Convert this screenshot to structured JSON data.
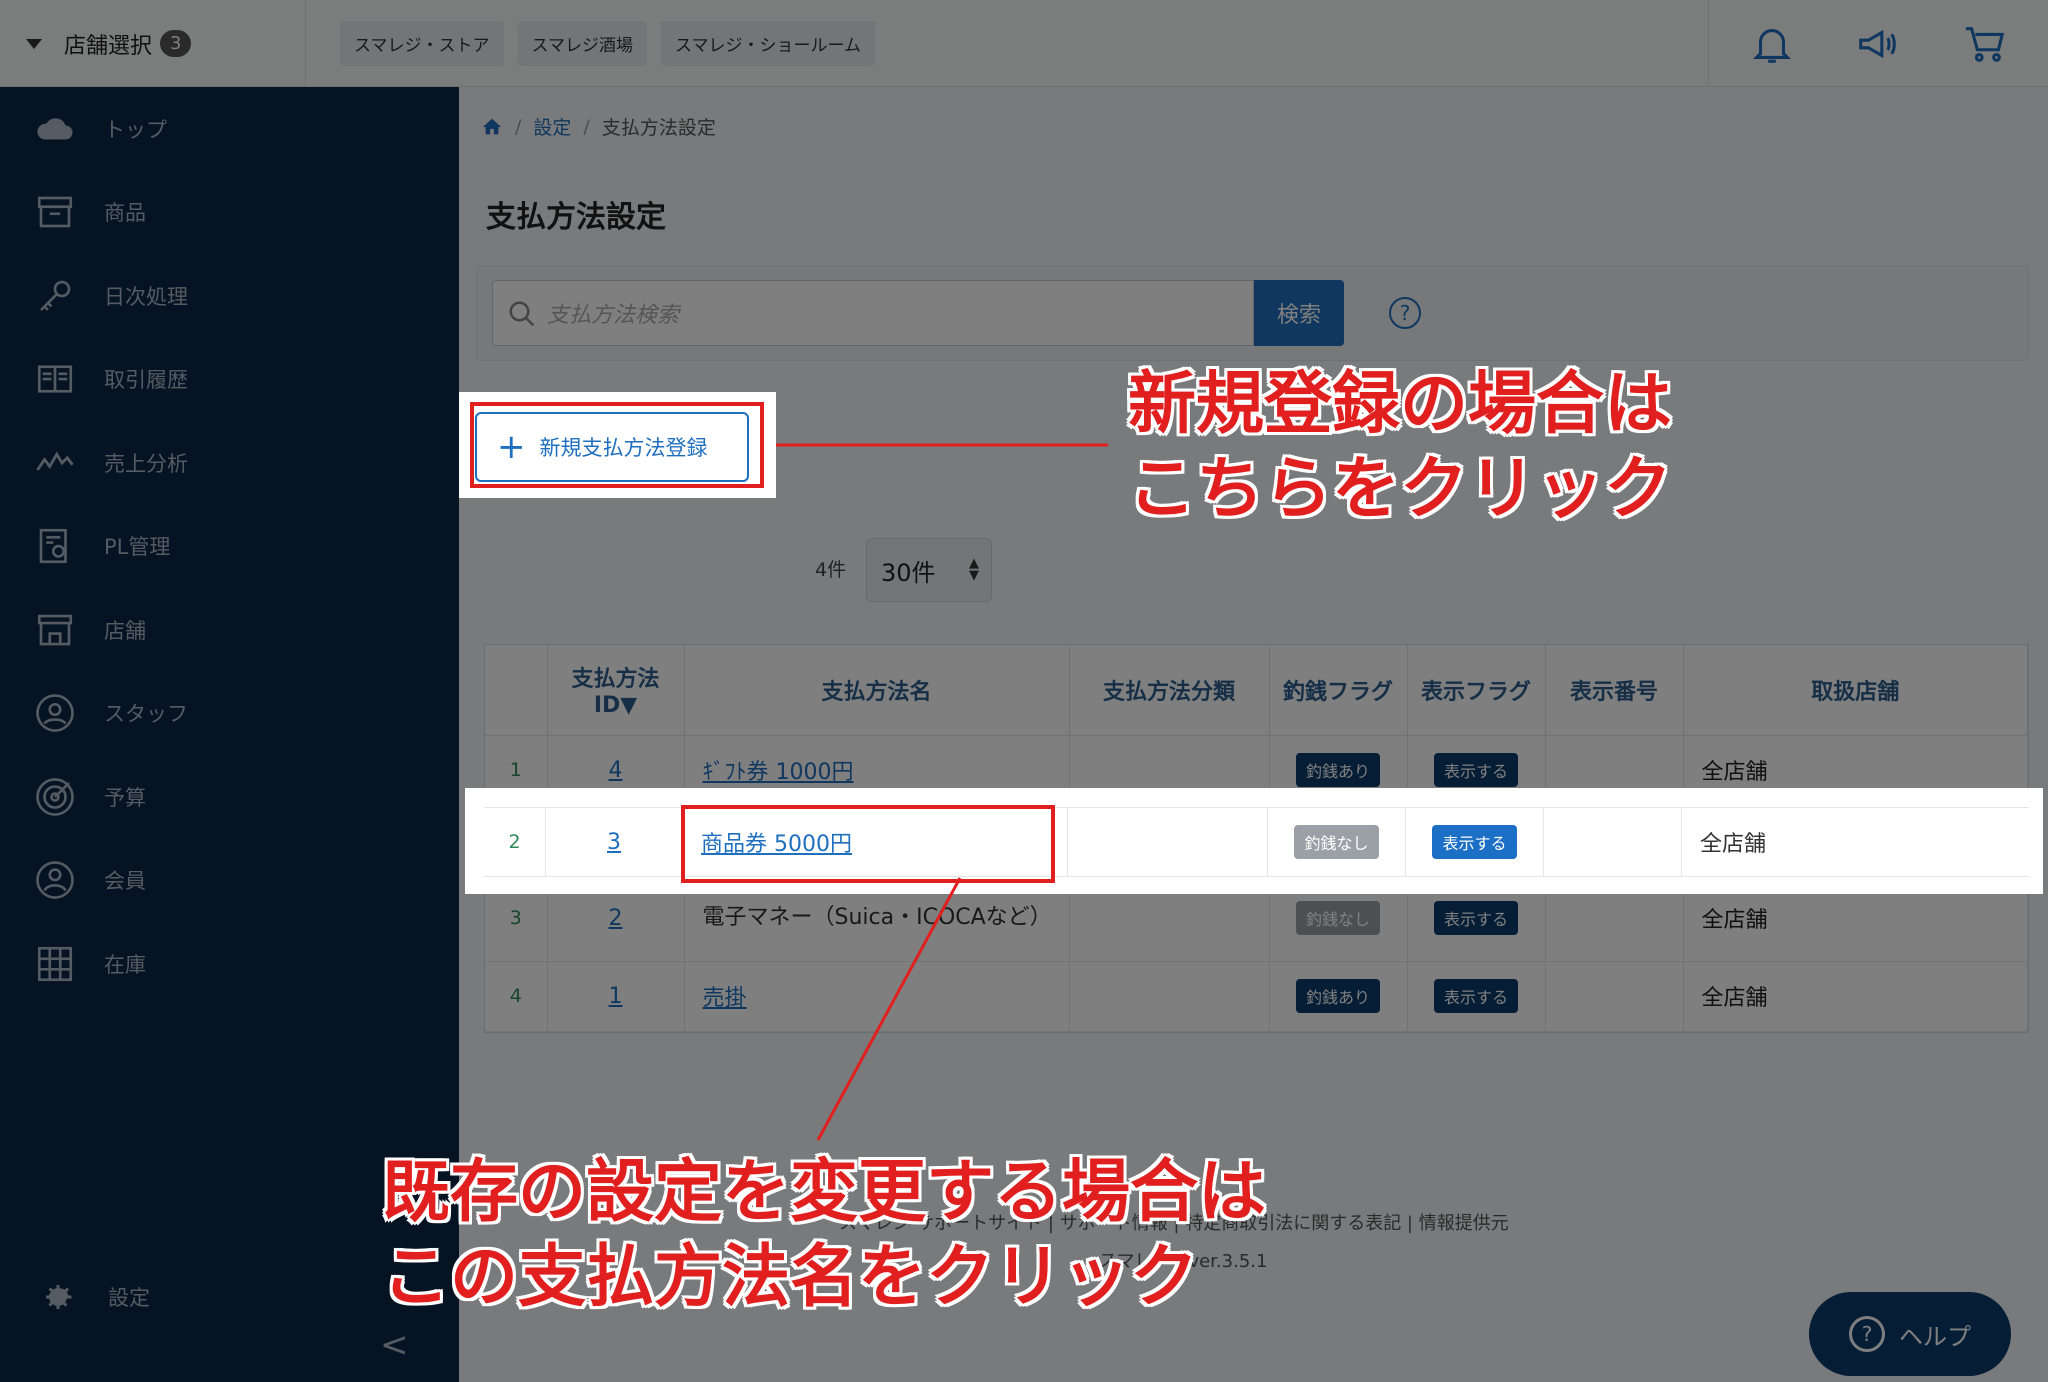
{
  "topbar": {
    "store_select_label": "店舗選択",
    "store_count": "3",
    "stores": [
      "スマレジ・ストア",
      "スマレジ酒場",
      "スマレジ・ショールーム"
    ]
  },
  "sidebar": {
    "items": [
      {
        "label": "トップ",
        "icon": "cloud-icon"
      },
      {
        "label": "商品",
        "icon": "box-icon"
      },
      {
        "label": "日次処理",
        "icon": "key-icon"
      },
      {
        "label": "取引履歴",
        "icon": "book-icon"
      },
      {
        "label": "売上分析",
        "icon": "chart-icon"
      },
      {
        "label": "PL管理",
        "icon": "report-icon"
      },
      {
        "label": "店舗",
        "icon": "store-icon"
      },
      {
        "label": "スタッフ",
        "icon": "staff-icon"
      },
      {
        "label": "予算",
        "icon": "target-icon"
      },
      {
        "label": "会員",
        "icon": "member-icon"
      },
      {
        "label": "在庫",
        "icon": "grid-icon"
      }
    ],
    "settings_label": "設定",
    "collapse_glyph": "<"
  },
  "breadcrumb": {
    "home": "home-icon",
    "settings": "設定",
    "current": "支払方法設定"
  },
  "page": {
    "title": "支払方法設定"
  },
  "search": {
    "placeholder": "支払方法検索",
    "button": "検索",
    "help": "?"
  },
  "new_button": {
    "label": "新規支払方法登録"
  },
  "pager": {
    "count": "4件",
    "per_page": "30件"
  },
  "table": {
    "headers": [
      "支払方法ID▼",
      "支払方法名",
      "支払方法分類",
      "釣銭フラグ",
      "表示フラグ",
      "表示番号",
      "取扱店舗"
    ],
    "header_id_line1": "支払方法",
    "header_id_line2": "ID▼",
    "rows": [
      {
        "no": "1",
        "id": "4",
        "name": "ｷﾞﾌﾄ券 1000円",
        "change_flag": "釣銭あり",
        "display_flag": "表示する",
        "stores": "全店舗"
      },
      {
        "no": "2",
        "id": "3",
        "name": "商品券 5000円",
        "change_flag": "釣銭なし",
        "display_flag": "表示する",
        "stores": "全店舗"
      },
      {
        "no": "3",
        "id": "2",
        "name": "電子マネー（Suica・ICOCAなど）",
        "change_flag": "釣銭なし",
        "display_flag": "表示する",
        "stores": "全店舗"
      },
      {
        "no": "4",
        "id": "1",
        "name": "売掛",
        "change_flag": "釣銭あり",
        "display_flag": "表示する",
        "stores": "全店舗"
      }
    ]
  },
  "footer": {
    "links": "スマレジ サポートサイト | サポート情報 | 特定商取引法に関する表記 | 情報提供元",
    "version": "スマレジ　ver.3.5.1"
  },
  "help_button": {
    "label": "ヘルプ"
  },
  "annotations": {
    "new_line1": "新規登録の場合は",
    "new_line2": "こちらをクリック",
    "edit_line1": "既存の設定を変更する場合は",
    "edit_line2": "この支払方法名をクリック"
  },
  "colors": {
    "accent": "#1f6fbf",
    "sidebar": "#0a2746",
    "annotation": "#e21f1f"
  }
}
